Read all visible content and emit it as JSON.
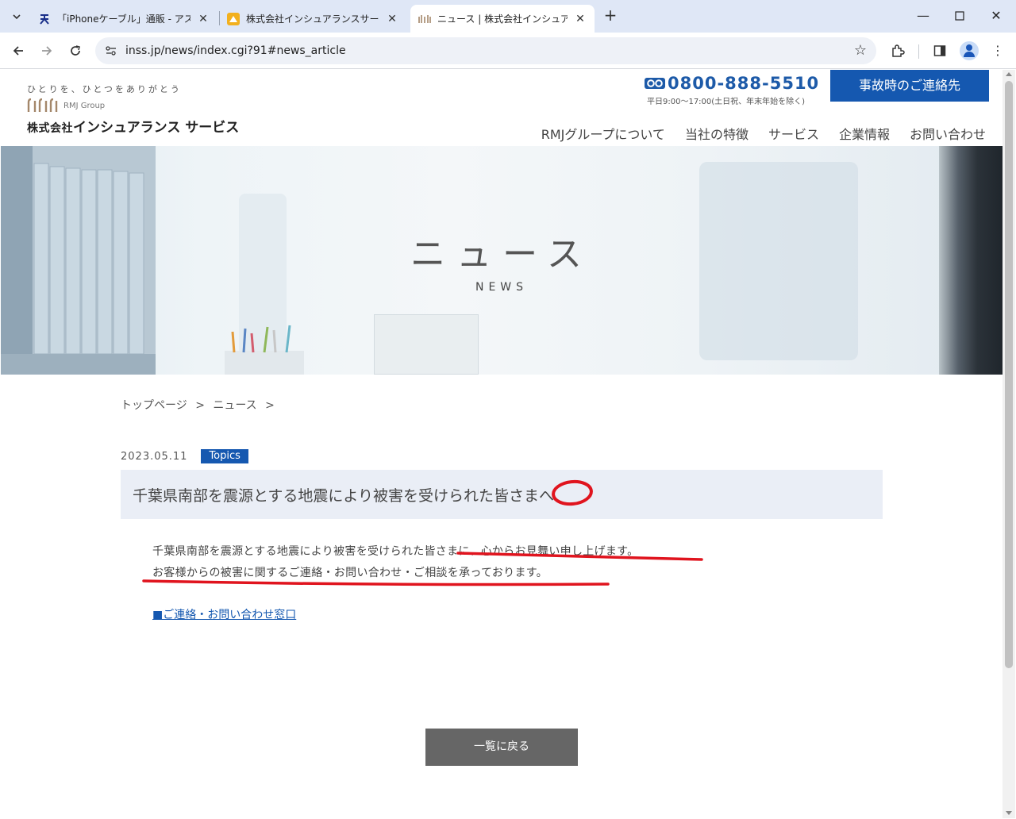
{
  "browser": {
    "tabs": [
      {
        "title": "「iPhoneケーブル」通販 - アスクル",
        "active": false
      },
      {
        "title": "株式会社インシュアランスサービス",
        "active": false
      },
      {
        "title": "ニュース | 株式会社インシュアランス",
        "active": true
      }
    ],
    "url": "inss.jp/news/index.cgi?91#news_article"
  },
  "header": {
    "tagline": "ひとりを、ひとつをありがとう",
    "group_label": "RMJ Group",
    "company_prefix": "株式会社",
    "company_name": "インシュアランス サービス",
    "phone": "0800-888-5510",
    "hours": "平日9:00〜17:00(土日祝、年末年始を除く)",
    "accident_button": "事故時のご連絡先",
    "nav": [
      "RMJグループについて",
      "当社の特徴",
      "サービス",
      "企業情報",
      "お問い合わせ"
    ]
  },
  "hero": {
    "title": "ニュース",
    "subtitle": "NEWS"
  },
  "breadcrumb": [
    "トップページ",
    ">",
    "ニュース",
    ">"
  ],
  "article": {
    "date": "2023.05.11",
    "category": "Topics",
    "title": "千葉県南部を震源とする地震により被害を受けられた皆さまへ",
    "body": [
      "千葉県南部を震源とする地震により被害を受けられた皆さまに、心からお見舞い申し上げます。",
      "お客様からの被害に関するご連絡・お問い合わせ・ご相談を承っております。"
    ],
    "link": "■ご連絡・お問い合わせ窓口"
  },
  "back_button": "一覧に戻る",
  "colors": {
    "brand_blue": "#1558b0",
    "annotation_red": "#e0141e"
  }
}
